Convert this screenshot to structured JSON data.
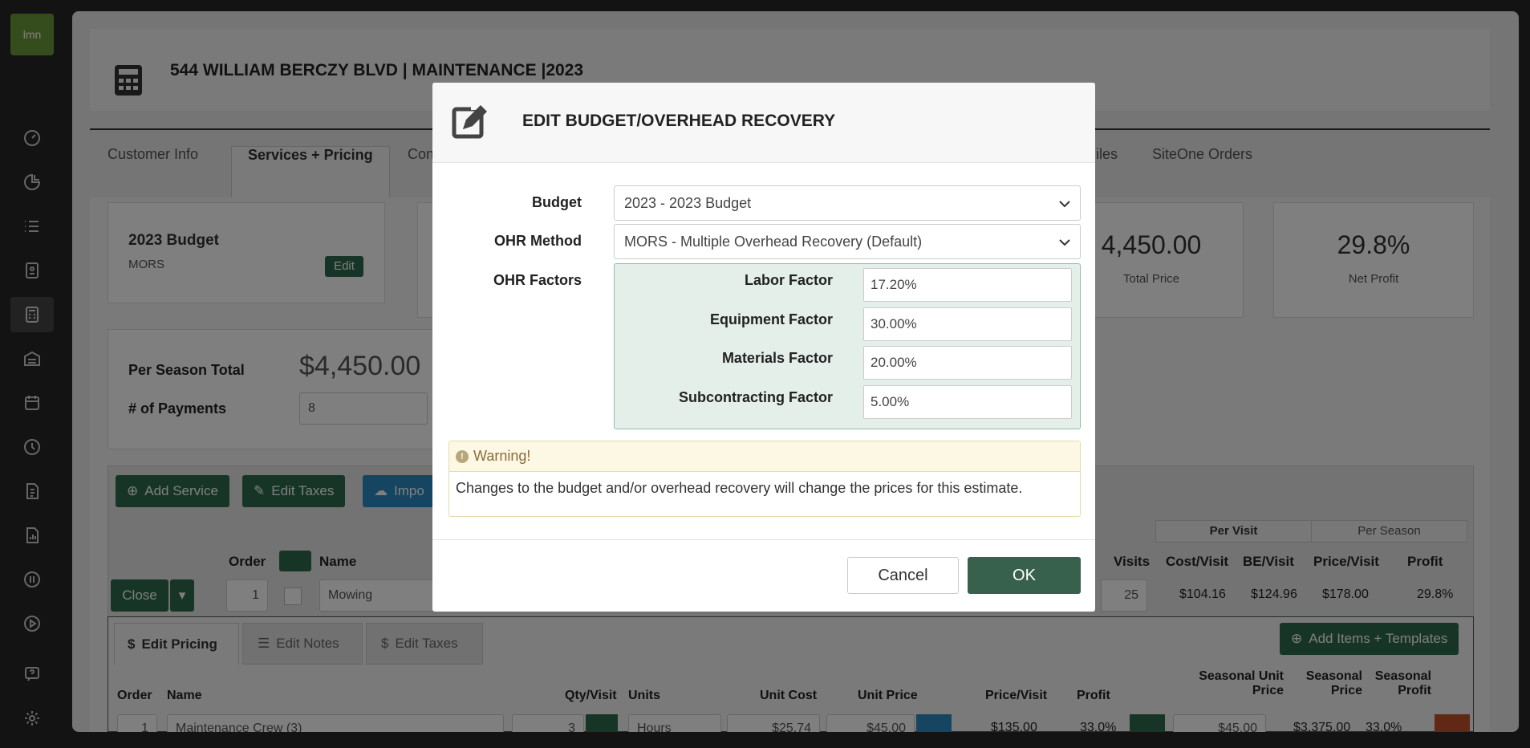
{
  "app": {
    "logo_text": "lmn",
    "accent": "#2e6b4f"
  },
  "sidebar": {
    "items": [
      {
        "icon": "dashboard-icon"
      },
      {
        "icon": "pie-chart-icon"
      },
      {
        "icon": "list-icon"
      },
      {
        "icon": "contact-icon"
      },
      {
        "icon": "calculator-icon"
      },
      {
        "icon": "warehouse-icon"
      },
      {
        "icon": "calendar-icon"
      },
      {
        "icon": "clock-icon"
      },
      {
        "icon": "invoice-icon"
      },
      {
        "icon": "report-icon"
      },
      {
        "icon": "quickbooks-icon"
      },
      {
        "icon": "play-icon"
      },
      {
        "icon": "help-icon"
      },
      {
        "icon": "gear-icon"
      }
    ]
  },
  "page": {
    "title": "544 WILLIAM BERCZY BLVD | MAINTENANCE |2023"
  },
  "tabs": [
    "Customer Info",
    "Services + Pricing",
    "Con",
    "iles",
    "SiteOne Orders"
  ],
  "budget_card": {
    "title": "2023 Budget",
    "method": "MORS",
    "edit_label": "Edit"
  },
  "kpis": [
    {
      "value": "4,450.00",
      "label": "Total Price"
    },
    {
      "value": "29.8%",
      "label": "Net Profit"
    }
  ],
  "season": {
    "label": "Per Season Total",
    "value": "$4,450.00",
    "payments_label": "# of Payments",
    "payments_value": "8"
  },
  "toolbar": {
    "add_service": "Add Service",
    "edit_taxes": "Edit Taxes",
    "import": "Impo"
  },
  "toggle": {
    "per_visit": "Per Visit",
    "per_season": "Per Season"
  },
  "service_table": {
    "headers": [
      "Order",
      "Name",
      "Visits",
      "Cost/Visit",
      "BE/Visit",
      "Price/Visit",
      "Profit"
    ],
    "row": {
      "close": "Close",
      "order": "1",
      "name": "Mowing",
      "visits": "25",
      "cost": "$104.16",
      "be": "$124.96",
      "price": "$178.00",
      "profit": "29.8%"
    }
  },
  "subtabs": {
    "edit_pricing": "Edit Pricing",
    "edit_notes": "Edit Notes",
    "edit_taxes": "Edit Taxes",
    "add_items": "Add Items + Templates"
  },
  "item_table": {
    "headers": [
      "Order",
      "Name",
      "Qty/Visit",
      "Units",
      "Unit Cost",
      "Unit Price",
      "Price/Visit",
      "Profit",
      "Seasonal Unit Price",
      "Seasonal Price",
      "Seasonal Profit"
    ],
    "row": {
      "order": "1",
      "name": "Maintenance Crew (3)",
      "qty": "3",
      "units": "Hours",
      "unit_cost": "$25.74",
      "unit_price": "$45.00",
      "price_visit": "$135.00",
      "profit": "33.0%",
      "seasonal_unit_price": "$45.00",
      "seasonal_price": "$3,375.00",
      "seasonal_profit": "33.0%"
    }
  },
  "modal": {
    "title": "EDIT BUDGET/OVERHEAD RECOVERY",
    "budget_label": "Budget",
    "budget_value": "2023 - 2023 Budget",
    "ohr_method_label": "OHR Method",
    "ohr_method_value": "MORS - Multiple Overhead Recovery (Default)",
    "ohr_factors_label": "OHR Factors",
    "factors": [
      {
        "label": "Labor Factor",
        "value": "17.20%"
      },
      {
        "label": "Equipment Factor",
        "value": "30.00%"
      },
      {
        "label": "Materials Factor",
        "value": "20.00%"
      },
      {
        "label": "Subcontracting Factor",
        "value": "5.00%"
      }
    ],
    "warning_title": "Warning!",
    "warning_text": "Changes to the budget and/or overhead recovery will change the prices for this estimate.",
    "cancel_label": "Cancel",
    "ok_label": "OK"
  }
}
